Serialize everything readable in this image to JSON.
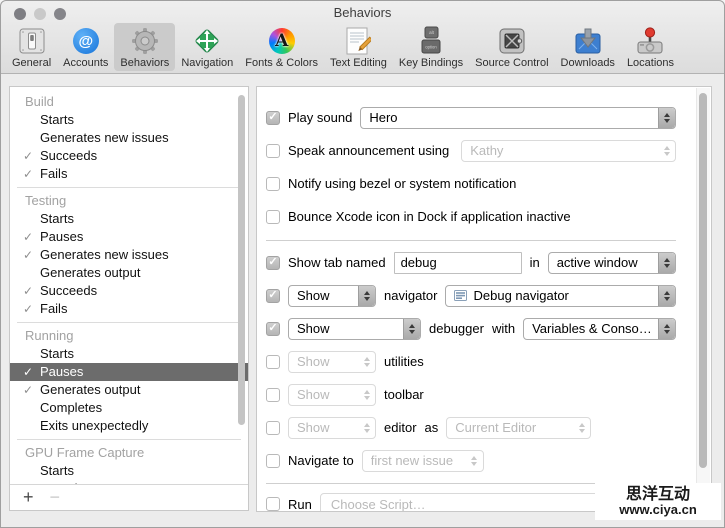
{
  "window": {
    "title": "Behaviors"
  },
  "toolbar": {
    "items": [
      {
        "label": "General",
        "icon": "general-icon",
        "selected": false
      },
      {
        "label": "Accounts",
        "icon": "accounts-icon",
        "selected": false
      },
      {
        "label": "Behaviors",
        "icon": "behaviors-gear-icon",
        "selected": true
      },
      {
        "label": "Navigation",
        "icon": "navigation-icon",
        "selected": false
      },
      {
        "label": "Fonts & Colors",
        "icon": "fonts-colors-icon",
        "selected": false
      },
      {
        "label": "Text Editing",
        "icon": "text-editing-icon",
        "selected": false
      },
      {
        "label": "Key Bindings",
        "icon": "key-bindings-icon",
        "selected": false
      },
      {
        "label": "Source Control",
        "icon": "source-control-icon",
        "selected": false
      },
      {
        "label": "Downloads",
        "icon": "downloads-icon",
        "selected": false
      },
      {
        "label": "Locations",
        "icon": "locations-icon",
        "selected": false
      }
    ]
  },
  "sidebar": {
    "groups": [
      {
        "header": "Build",
        "items": [
          {
            "label": "Starts",
            "checked": false
          },
          {
            "label": "Generates new issues",
            "checked": false
          },
          {
            "label": "Succeeds",
            "checked": true
          },
          {
            "label": "Fails",
            "checked": true
          }
        ]
      },
      {
        "header": "Testing",
        "items": [
          {
            "label": "Starts",
            "checked": false
          },
          {
            "label": "Pauses",
            "checked": true
          },
          {
            "label": "Generates new issues",
            "checked": true
          },
          {
            "label": "Generates output",
            "checked": false
          },
          {
            "label": "Succeeds",
            "checked": true
          },
          {
            "label": "Fails",
            "checked": true
          }
        ]
      },
      {
        "header": "Running",
        "items": [
          {
            "label": "Starts",
            "checked": false
          },
          {
            "label": "Pauses",
            "checked": true,
            "selected": true
          },
          {
            "label": "Generates output",
            "checked": true
          },
          {
            "label": "Completes",
            "checked": false
          },
          {
            "label": "Exits unexpectedly",
            "checked": false
          }
        ]
      },
      {
        "header": "GPU Frame Capture",
        "items": [
          {
            "label": "Starts",
            "checked": false
          },
          {
            "label": "Completes",
            "checked": true
          }
        ]
      }
    ],
    "add_button": "+",
    "remove_button": "−"
  },
  "main": {
    "play_sound": {
      "label": "Play sound",
      "checked": true,
      "value": "Hero"
    },
    "speak": {
      "label": "Speak announcement using",
      "checked": false,
      "value": "Kathy"
    },
    "notify": {
      "label": "Notify using bezel or system notification",
      "checked": false
    },
    "bounce": {
      "label": "Bounce Xcode icon in Dock if application inactive",
      "checked": false
    },
    "show_tab": {
      "label": "Show tab named",
      "checked": true,
      "field_value": "debug",
      "conjunction": "in",
      "value": "active window"
    },
    "navigator": {
      "checked": true,
      "action": "Show",
      "label": "navigator",
      "value": "Debug navigator"
    },
    "debugger": {
      "checked": true,
      "action": "Show",
      "label": "debugger",
      "conjunction": "with",
      "value": "Variables & Consol…"
    },
    "utilities": {
      "checked": false,
      "action": "Show",
      "label": "utilities"
    },
    "toolbar_row": {
      "checked": false,
      "action": "Show",
      "label": "toolbar"
    },
    "editor": {
      "checked": false,
      "action": "Show",
      "label": "editor",
      "conjunction": "as",
      "value": "Current Editor"
    },
    "navigate": {
      "checked": false,
      "label": "Navigate to",
      "value": "first new issue"
    },
    "run": {
      "checked": false,
      "label": "Run",
      "value": "Choose Script…"
    }
  },
  "colors": {
    "selection_gray": "#6c6c6c",
    "accounts_blue": "#1673d9",
    "navigation_green": "#2ea357",
    "downloads_blue": "#3d7fd0",
    "locations_red": "#e03b30"
  },
  "watermark": {
    "line1": "思洋互动",
    "line2": "www.ciya.cn"
  }
}
